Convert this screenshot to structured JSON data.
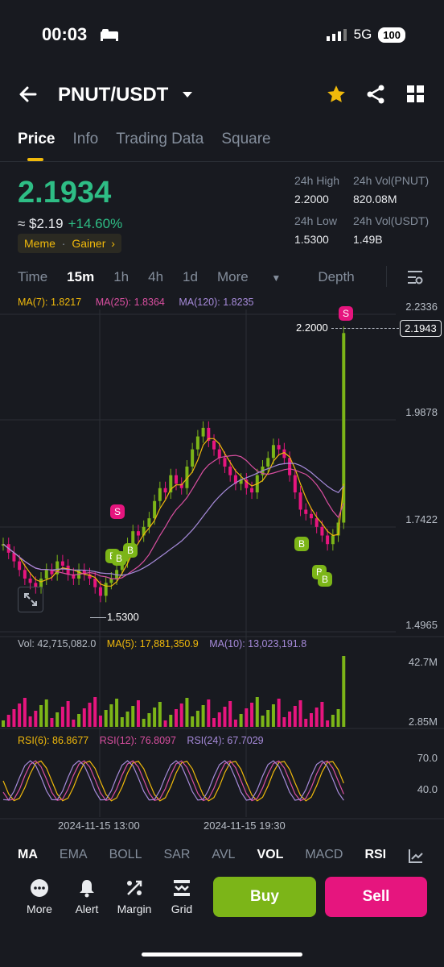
{
  "status": {
    "time": "00:03",
    "network": "5G",
    "battery": "100"
  },
  "header": {
    "pair": "PNUT/USDT"
  },
  "tabs": [
    "Price",
    "Info",
    "Trading Data",
    "Square"
  ],
  "ticker": {
    "price": "2.1934",
    "approx": "≈ $2.19",
    "change": "+14.60%",
    "tag1": "Meme",
    "tag2": "Gainer",
    "high_label": "24h High",
    "high": "2.2000",
    "vol_pnut_label": "24h Vol(PNUT)",
    "vol_pnut": "820.08M",
    "low_label": "24h Low",
    "low": "1.5300",
    "vol_usdt_label": "24h Vol(USDT)",
    "vol_usdt": "1.49B"
  },
  "timeframes": [
    "Time",
    "15m",
    "1h",
    "4h",
    "1d",
    "More",
    "Depth"
  ],
  "ma": {
    "ma7": "MA(7): 1.8217",
    "ma25": "MA(25): 1.8364",
    "ma120": "MA(120): 1.8235"
  },
  "price_axis": [
    "2.2336",
    "1.9878",
    "1.7422",
    "1.4965"
  ],
  "price_marks": {
    "high": "2.2000",
    "current": "2.1943",
    "low": "1.5300"
  },
  "signals": {
    "s": "S",
    "b": "B"
  },
  "volume": {
    "vol": "Vol: 42,715,082.0",
    "ma5": "MA(5): 17,881,350.9",
    "ma10": "MA(10): 13,023,191.8",
    "axis_top": "42.7M",
    "axis_bottom": "2.85M"
  },
  "rsi": {
    "rsi6": "RSI(6): 86.8677",
    "rsi12": "RSI(12): 76.8097",
    "rsi24": "RSI(24): 67.7029",
    "axis_top": "70.0",
    "axis_bottom": "40.0"
  },
  "dates": [
    "2024-11-15 13:00",
    "2024-11-15 19:30"
  ],
  "indicators": [
    "MA",
    "EMA",
    "BOLL",
    "SAR",
    "AVL",
    "VOL",
    "MACD",
    "RSI"
  ],
  "actions": [
    "More",
    "Alert",
    "Margin",
    "Grid"
  ],
  "buy": "Buy",
  "sell": "Sell",
  "colors": {
    "up": "#2ebd85",
    "down": "#f6465d",
    "accent": "#f0b90b",
    "candle_up": "#7cb518",
    "candle_down": "#e6157e"
  }
}
